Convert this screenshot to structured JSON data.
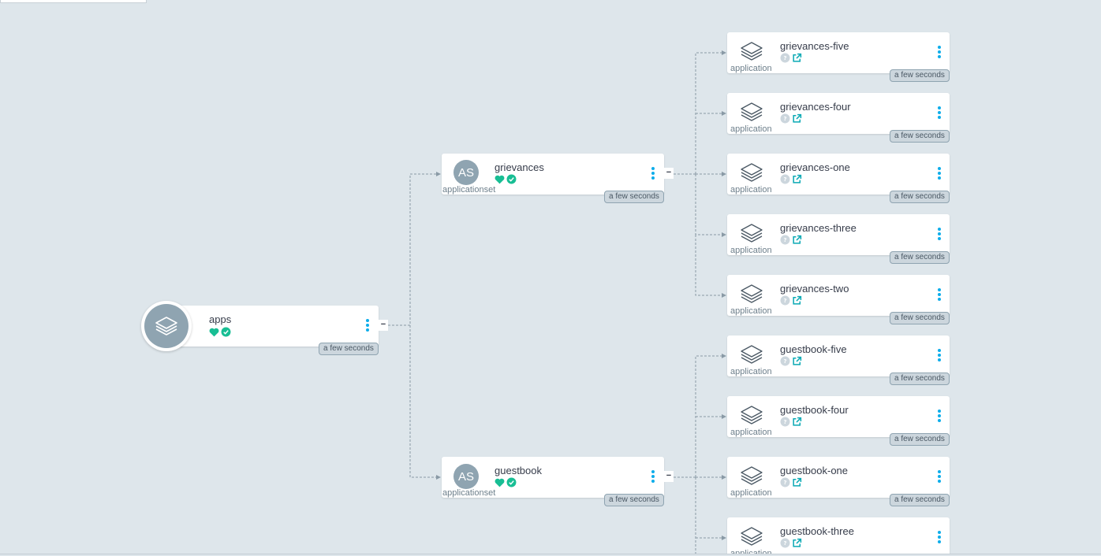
{
  "root": {
    "title": "apps",
    "age": "a few seconds",
    "health": "healthy",
    "sync": "synced"
  },
  "appsets": [
    {
      "title": "grievances",
      "icon_text": "AS",
      "kind": "applicationset",
      "age": "a few seconds",
      "collapse_symbol": "−"
    },
    {
      "title": "guestbook",
      "icon_text": "AS",
      "kind": "applicationset",
      "age": "a few seconds",
      "collapse_symbol": "−"
    }
  ],
  "root_collapse_symbol": "−",
  "apps": [
    {
      "title": "grievances-five",
      "kind": "application",
      "age": "a few seconds"
    },
    {
      "title": "grievances-four",
      "kind": "application",
      "age": "a few seconds"
    },
    {
      "title": "grievances-one",
      "kind": "application",
      "age": "a few seconds"
    },
    {
      "title": "grievances-three",
      "kind": "application",
      "age": "a few seconds"
    },
    {
      "title": "grievances-two",
      "kind": "application",
      "age": "a few seconds"
    },
    {
      "title": "guestbook-five",
      "kind": "application",
      "age": "a few seconds"
    },
    {
      "title": "guestbook-four",
      "kind": "application",
      "age": "a few seconds"
    },
    {
      "title": "guestbook-one",
      "kind": "application",
      "age": "a few seconds"
    },
    {
      "title": "guestbook-three",
      "kind": "application",
      "age": ""
    }
  ],
  "icons": {
    "health": "heart-icon",
    "sync": "check-circle-icon",
    "unknown": "question-circle-icon",
    "external": "external-link-icon",
    "menu": "kebab-menu-icon",
    "app": "layers-icon"
  },
  "colors": {
    "background": "#dee6eb",
    "healthy": "#18be94",
    "link": "#0dadea",
    "unknown": "#ccd6dd",
    "icon_bg": "#8fa4b1"
  }
}
